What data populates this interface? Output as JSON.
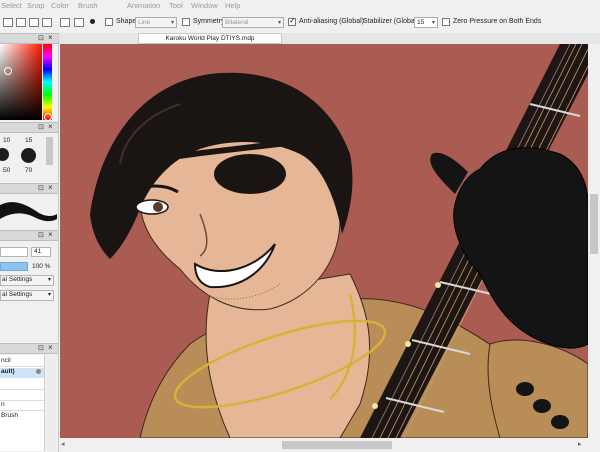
{
  "menu": [
    "Select",
    "Snap",
    "Color",
    "Brush",
    "Animation",
    "Tool",
    "Window",
    "Help"
  ],
  "toolbar": {
    "shape_label": "Shape",
    "shape_value": "Line",
    "symmetry_label": "Symmetry",
    "symmetry_value": "Bilateral",
    "antialias_label": "Anti-aliasing (Global)",
    "stabilizer_label": "Stabilizer (Global)",
    "stabilizer_value": "15",
    "zero_pressure_label": "Zero Pressure on Both Ends"
  },
  "document": {
    "tab_title": "Karoku World Play DTIYS.mdp"
  },
  "brush_sizes": [
    "10",
    "15",
    "50",
    "70"
  ],
  "brush_control": {
    "size_value": "41",
    "opacity_value": "100 %",
    "opacity_fraction": 1.0
  },
  "settings_dropdowns": [
    "al Settings",
    "al Settings"
  ],
  "brush_list": [
    "ncil",
    "ault)",
    "n",
    "Brush"
  ],
  "colors": {
    "canvas_bg": "#ab5c52",
    "hair": "#1a1513",
    "skin": "#e6b796",
    "jacket": "#b98d58",
    "accent_blue": "#2f7bd6"
  }
}
